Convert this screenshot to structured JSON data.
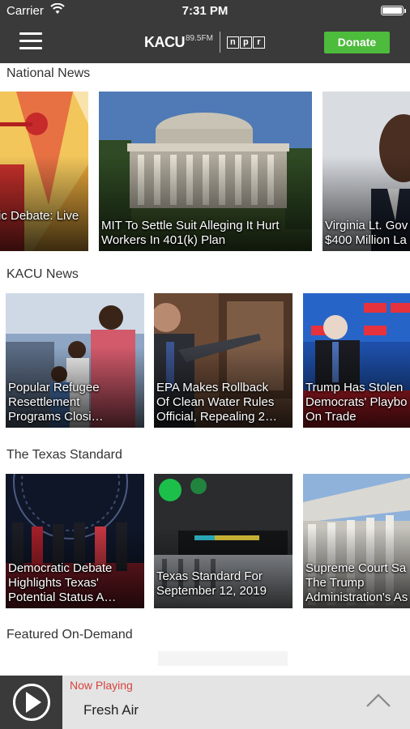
{
  "status": {
    "carrier": "Carrier",
    "time": "7:31 PM"
  },
  "header": {
    "donate_label": "Donate",
    "logo_text": "KACU",
    "logo_freq": "89.5FM",
    "npr_letters": [
      "n",
      "p",
      "r"
    ]
  },
  "sections": [
    {
      "title": "National News",
      "cards": [
        {
          "lines": [
            "ic Debate: Live"
          ],
          "image": "debate-stage-art"
        },
        {
          "lines": [
            "MIT To Settle Suit Alleging It Hurt",
            "Workers In 401(k) Plan"
          ],
          "image": "mit-dome-building"
        },
        {
          "lines": [
            "Virginia Lt. Gov",
            "$400 Million La"
          ],
          "image": "portrait-man"
        }
      ]
    },
    {
      "title": "KACU News",
      "cards": [
        {
          "lines": [
            "Popular Refugee",
            "Resettlement",
            "Programs Closi…"
          ],
          "image": "refugee-family"
        },
        {
          "lines": [
            "EPA Makes Rollback",
            "Of Clean Water Rules",
            "Official, Repealing 2…"
          ],
          "image": "official-pointing"
        },
        {
          "lines": [
            "Trump Has Stolen",
            "Democrats' Playbo",
            "On Trade"
          ],
          "image": "sanders-cnn-debate"
        }
      ]
    },
    {
      "title": "The Texas Standard",
      "cards": [
        {
          "lines": [
            "Democratic Debate",
            "Highlights Texas'",
            "Potential Status A…"
          ],
          "image": "debate-candidates"
        },
        {
          "lines": [
            "Texas Standard For",
            "September 12, 2019"
          ],
          "image": "audio-mixer"
        },
        {
          "lines": [
            "Supreme Court Sa",
            "The Trump",
            "Administration's As"
          ],
          "image": "supreme-court"
        }
      ]
    },
    {
      "title": "Featured On-Demand",
      "cards": []
    }
  ],
  "player": {
    "now_playing_label": "Now Playing",
    "title": "Fresh Air"
  },
  "colors": {
    "bar": "#3a3a3a",
    "donate": "#4dbb3c",
    "now_playing": "#d6433e"
  },
  "icons": [
    "wifi-icon",
    "battery-icon",
    "hamburger-menu-icon",
    "play-icon",
    "chevron-up-icon"
  ]
}
